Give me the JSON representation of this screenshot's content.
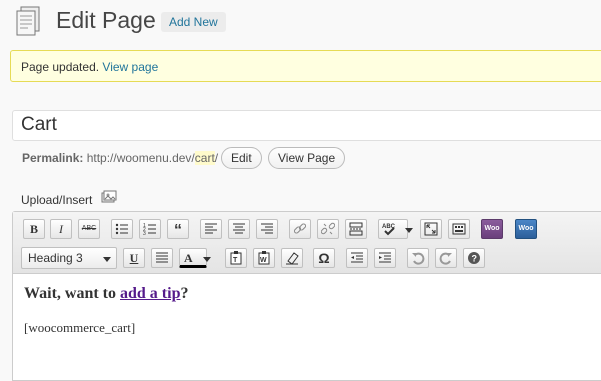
{
  "header": {
    "title": "Edit Page",
    "add_new_label": "Add New"
  },
  "notice": {
    "text": "Page updated.",
    "link": "View page"
  },
  "title_field": {
    "value": "Cart"
  },
  "permalink": {
    "label": "Permalink:",
    "base_url": "http://woomenu.dev/",
    "slug": "cart",
    "suffix": "/",
    "edit_label": "Edit",
    "view_label": "View Page"
  },
  "upload": {
    "label": "Upload/Insert"
  },
  "toolbar": {
    "row1": [
      "bold-icon",
      "italic-icon",
      "strikethrough-icon",
      "bullet-list-icon",
      "numbered-list-icon",
      "blockquote-icon",
      "align-left-icon",
      "align-center-icon",
      "align-right-icon",
      "link-icon",
      "unlink-icon",
      "more-tag-icon",
      "spellcheck-icon",
      "fullscreen-icon",
      "kitchen-sink-icon",
      "woocommerce-icon",
      "woocommerce-shortcodes-icon"
    ],
    "format_select": "Heading 3",
    "row2": [
      "underline-icon",
      "justify-icon",
      "text-color-icon",
      "paste-text-icon",
      "paste-word-icon",
      "clear-formatting-icon",
      "special-character-icon",
      "outdent-icon",
      "indent-icon",
      "undo-icon",
      "redo-icon",
      "help-icon"
    ],
    "bold_text": "B",
    "italic_text": "I",
    "strike_text": "ABC",
    "underline_text": "U",
    "text_color_text": "A",
    "omega_text": "Ω",
    "woo_text": "Woo"
  },
  "content": {
    "heading_pre": "Wait, want to",
    "heading_link": "add a tip",
    "heading_post": "?",
    "shortcode": "[woocommerce_cart]"
  }
}
